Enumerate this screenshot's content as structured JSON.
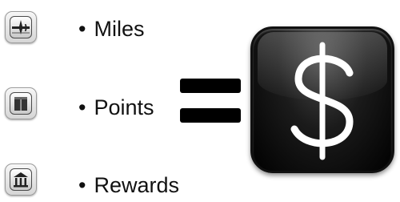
{
  "items": [
    {
      "label": "Miles",
      "icon": "airplane-icon"
    },
    {
      "label": "Points",
      "icon": "book-icon"
    },
    {
      "label": "Rewards",
      "icon": "bank-icon"
    }
  ],
  "bullet_glyph": "•",
  "equals": {
    "symbol": "="
  },
  "currency": {
    "symbol": "$",
    "icon": "dollar-icon"
  },
  "colors": {
    "text": "#111111",
    "tile": "#000000",
    "tile_symbol": "#ffffff"
  }
}
